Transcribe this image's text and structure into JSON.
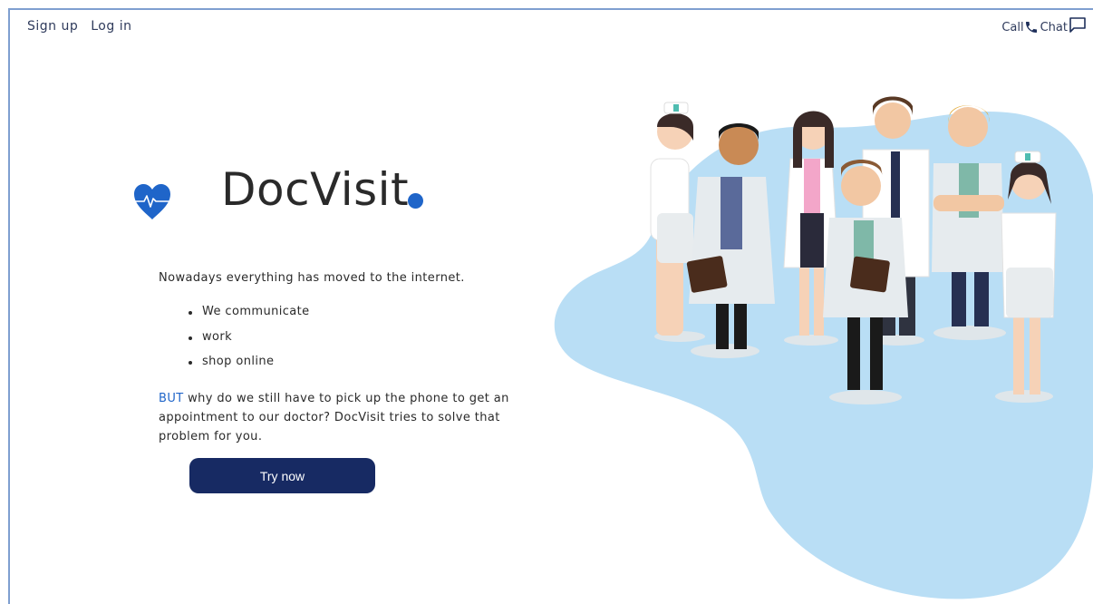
{
  "nav": {
    "signup_label": "Sign up",
    "login_label": "Log in",
    "call_label": "Call",
    "chat_label": "Chat"
  },
  "brand": {
    "name": "DocVisit",
    "accent_color": "#1f65c9",
    "logo_icon": "heart-pulse-icon"
  },
  "hero": {
    "intro": "Nowadays everything has moved to the internet.",
    "bullets": [
      "We communicate",
      "work",
      "shop online"
    ],
    "highlight": "BUT",
    "pitch_rest": " why do we still have to pick up the phone to get an appointment to our doctor? DocVisit tries to solve that problem for you.",
    "cta_label": "Try now",
    "cta_color": "#172a63"
  },
  "illustration": {
    "icon": "medical-team-illustration",
    "blob_color": "#b9def5"
  }
}
